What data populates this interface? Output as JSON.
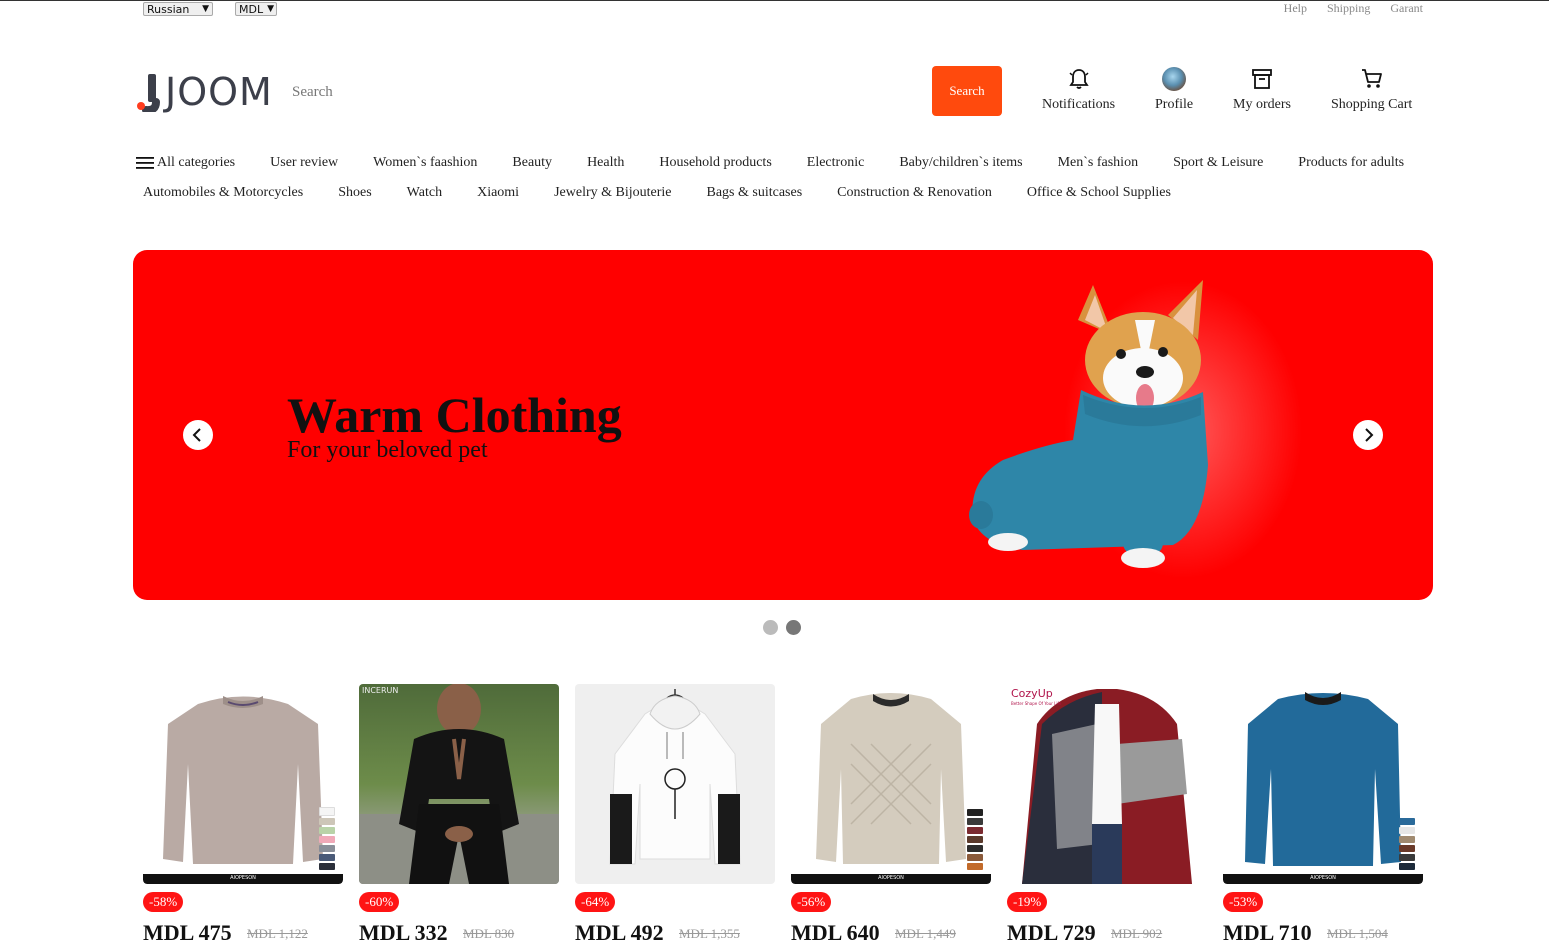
{
  "topbar": {
    "language": "Russian",
    "currency": "MDL",
    "links": [
      "Help",
      "Shipping",
      "Garant"
    ]
  },
  "header": {
    "logo_text": "JOOM",
    "search_placeholder": "Search",
    "search_button": "Search",
    "nav": {
      "notifications": "Notifications",
      "profile": "Profile",
      "orders": "My orders",
      "cart": "Shopping Cart"
    }
  },
  "categories": {
    "row1": [
      "All categories",
      "User review",
      "Women`s faashion",
      "Beauty",
      "Health",
      "Household products",
      "Electronic",
      "Baby/children`s items",
      "Men`s fashion",
      "Sport & Leisure",
      "Products for adults"
    ],
    "row2": [
      "Automobiles & Motorcycles",
      "Shoes",
      "Watch",
      "Xiaomi",
      "Jewelry & Bijouterie",
      "Bags & suitcases",
      "Construction & Renovation",
      "Office & School Supplies"
    ]
  },
  "banner": {
    "title": "Warm Clothing",
    "subtitle": "For your beloved pet",
    "slide_count": 2,
    "active_slide": 2
  },
  "products": [
    {
      "discount": "-58%",
      "price": "MDL 475",
      "old_price": "MDL 1,122",
      "brand": "AIOPESON"
    },
    {
      "discount": "-60%",
      "price": "MDL 332",
      "old_price": "MDL 830",
      "brand": "INCERUN"
    },
    {
      "discount": "-64%",
      "price": "MDL 492",
      "old_price": "MDL 1,355",
      "brand": ""
    },
    {
      "discount": "-56%",
      "price": "MDL 640",
      "old_price": "MDL 1,449",
      "brand": "AIOPESON"
    },
    {
      "discount": "-19%",
      "price": "MDL 729",
      "old_price": "MDL 902",
      "brand": "CozyUp",
      "tagline": "Better Shape Of Your Life"
    },
    {
      "discount": "-53%",
      "price": "MDL 710",
      "old_price": "MDL 1,504",
      "brand": "AIOPESON"
    }
  ],
  "colors": {
    "accent": "#ff4a0d",
    "banner": "#ff0000",
    "badge": "#ff1414"
  }
}
